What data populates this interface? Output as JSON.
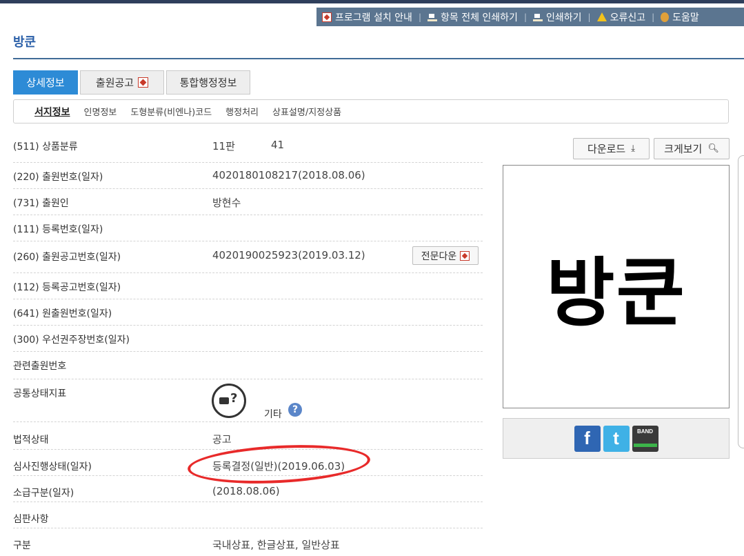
{
  "util_nav": [
    {
      "label": "프로그램 설치 안내",
      "icon": "pdf-icon"
    },
    {
      "label": "항목 전체 인쇄하기",
      "icon": "print-icon"
    },
    {
      "label": "인쇄하기",
      "icon": "print-icon"
    },
    {
      "label": "오류신고",
      "icon": "warning-icon"
    },
    {
      "label": "도움말",
      "icon": "help-icon"
    }
  ],
  "page": {
    "title": "방쿤"
  },
  "tabs": [
    {
      "label": "상세정보",
      "active": true
    },
    {
      "label": "출원공고",
      "active": false
    },
    {
      "label": "통합행정정보",
      "active": false
    }
  ],
  "subtabs": [
    {
      "label": "서지정보",
      "active": true
    },
    {
      "label": "인명정보",
      "active": false
    },
    {
      "label": "도형분류(비엔나)코드",
      "active": false
    },
    {
      "label": "행정처리",
      "active": false
    },
    {
      "label": "상표설명/지정상품",
      "active": false
    }
  ],
  "details": {
    "product_class": {
      "label": "(511) 상품분류",
      "edition": "11판",
      "class_no": "41"
    },
    "application_no": {
      "label": "(220) 출원번호(일자)",
      "value": "4020180108217(2018.08.06)"
    },
    "applicant": {
      "label": "(731) 출원인",
      "value": "방현수"
    },
    "registration_no": {
      "label": "(111) 등록번호(일자)",
      "value": ""
    },
    "publication_no": {
      "label": "(260) 출원공고번호(일자)",
      "value": "4020190025923(2019.03.12)",
      "button": "전문다운"
    },
    "reg_publication_no": {
      "label": "(112) 등록공고번호(일자)",
      "value": ""
    },
    "original_app_no": {
      "label": "(641) 원출원번호(일자)",
      "value": ""
    },
    "priority_no": {
      "label": "(300) 우선권주장번호(일자)",
      "value": ""
    },
    "related_app_no": {
      "label": "관련출원번호",
      "value": ""
    },
    "common_status": {
      "label": "공통상태지표",
      "value": "기타"
    },
    "legal_status": {
      "label": "법적상태",
      "value": "공고"
    },
    "exam_status": {
      "label": "심사진행상태(일자)",
      "value": "등록결정(일반)(2019.06.03)"
    },
    "retroactive": {
      "label": "소급구분(일자)",
      "value": "(2018.08.06)"
    },
    "trial": {
      "label": "심판사항",
      "value": ""
    },
    "category": {
      "label": "구분",
      "value": "국내상표, 한글상표, 일반상표"
    }
  },
  "image_panel": {
    "download_label": "다운로드",
    "zoom_label": "크게보기",
    "mark_text": "방쿤"
  },
  "share": {
    "facebook": "f",
    "twitter": "t",
    "band": "BAND"
  },
  "colors": {
    "accent": "#2d8bd6",
    "util_bar": "#5b7590",
    "title": "#2a5fa8",
    "highlight": "#e82a2a"
  }
}
